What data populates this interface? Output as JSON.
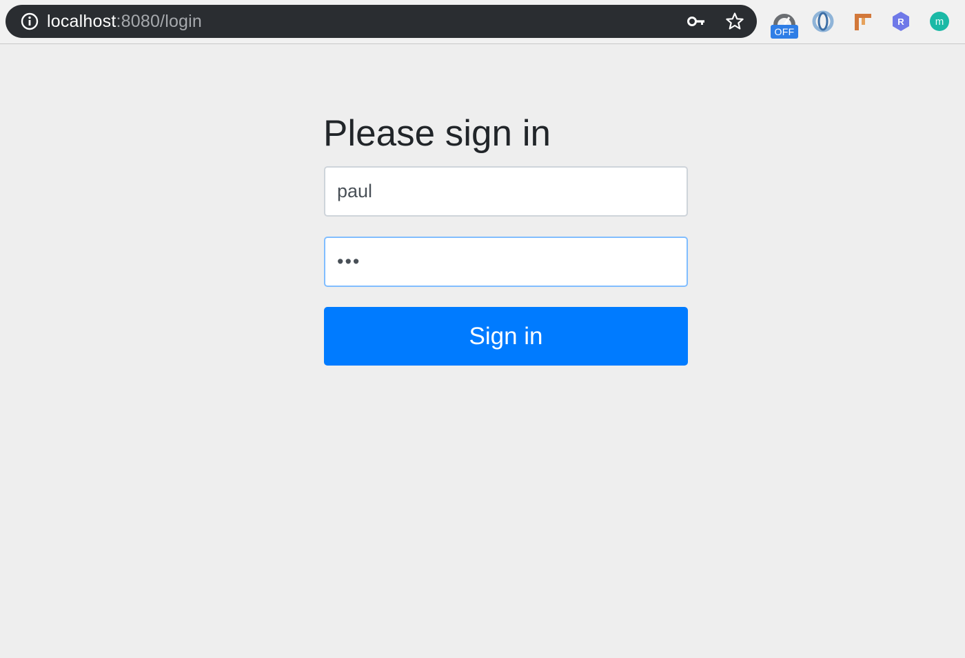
{
  "browser": {
    "url_host": "localhost",
    "url_path": ":8080/login",
    "icons": {
      "info": "info-icon",
      "password_key": "key-icon",
      "bookmark": "star-icon"
    },
    "extensions": [
      {
        "name": "speed-extension-icon",
        "badge": "OFF",
        "badge_color": "#2f7ee6"
      },
      {
        "name": "loop-extension-icon",
        "color": "#8fb4d8"
      },
      {
        "name": "pipe-extension-icon",
        "color": "#d2783a"
      },
      {
        "name": "hexagon-r-extension-icon",
        "label": "R",
        "color": "#6f79e8"
      },
      {
        "name": "m-circle-extension-icon",
        "label": "m",
        "color": "#1bb9a6"
      }
    ]
  },
  "form": {
    "title": "Please sign in",
    "username_value": "paul",
    "password_value": "abc",
    "submit_label": "Sign in",
    "accent_color": "#007bff",
    "focus_border_color": "#80bdff"
  }
}
